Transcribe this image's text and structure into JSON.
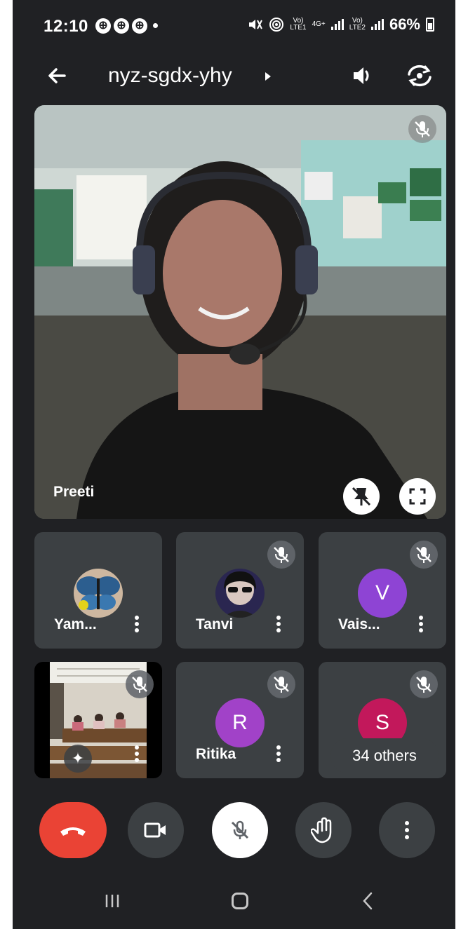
{
  "status": {
    "time": "12:10",
    "notif_icons": [
      "⊕",
      "⊕",
      "⊕"
    ],
    "battery": "66%",
    "net_label_1": "Vo)",
    "net_label_1b": "LTE1",
    "net_label_2": "4G+",
    "net_label_3": "Vo)",
    "net_label_3b": "LTE2"
  },
  "header": {
    "meeting_code": "nyz-sgdx-yhy"
  },
  "main_video": {
    "name": "Preeti"
  },
  "tiles": [
    {
      "name": "Yam..."
    },
    {
      "name": "Tanvi"
    },
    {
      "name": "Vais...",
      "initial": "V",
      "color": "#8e44d4"
    },
    {
      "name": ""
    },
    {
      "name": "Ritika",
      "initial": "R",
      "color": "#a142c8"
    },
    {
      "name": "",
      "initial": "S",
      "color": "#c2185b"
    }
  ],
  "others_chip": "34 others",
  "effects_icon": "✦",
  "colors": {
    "background": "#202124",
    "tile": "#3c4043",
    "end_call": "#ea4335"
  }
}
